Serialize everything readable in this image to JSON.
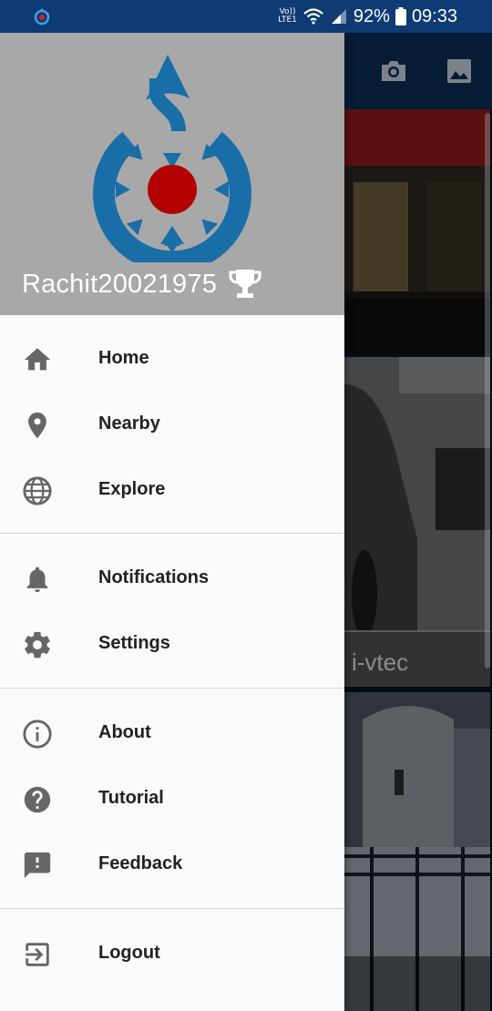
{
  "status_bar": {
    "volte_top": "Vo))",
    "volte_bottom": "LTE1",
    "battery": "92%",
    "time": "09:33"
  },
  "toolbar": {
    "icons": [
      "camera-icon",
      "gallery-icon"
    ]
  },
  "background_cards": [
    {
      "label": ""
    },
    {
      "label": "i-vtec"
    },
    {
      "label": ""
    }
  ],
  "drawer": {
    "username": "Rachit20021975",
    "groups": [
      [
        {
          "label": "Home",
          "icon": "home-icon"
        },
        {
          "label": "Nearby",
          "icon": "location-pin-icon"
        },
        {
          "label": "Explore",
          "icon": "globe-icon"
        }
      ],
      [
        {
          "label": "Notifications",
          "icon": "bell-icon"
        },
        {
          "label": "Settings",
          "icon": "gear-icon"
        }
      ],
      [
        {
          "label": "About",
          "icon": "info-icon"
        },
        {
          "label": "Tutorial",
          "icon": "help-icon"
        },
        {
          "label": "Feedback",
          "icon": "feedback-icon"
        }
      ],
      [
        {
          "label": "Logout",
          "icon": "logout-icon"
        }
      ]
    ]
  },
  "colors": {
    "status_bar": "#0e3b73",
    "drawer_header": "#a8a8a8",
    "logo_blue": "#1a6ea8",
    "logo_red": "#b30000",
    "menu_icon": "#666666"
  }
}
